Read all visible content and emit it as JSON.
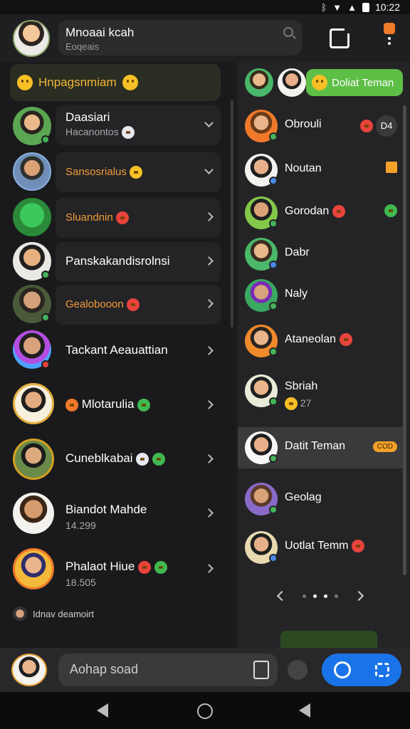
{
  "status": {
    "time": "10:22"
  },
  "header": {
    "title": "Mnoaai kcah",
    "subtitle": "Eoqeais"
  },
  "promo": {
    "text": "Hnpagsnmiam"
  },
  "chats": [
    {
      "name": "Daasiari",
      "sub": "Hacanontos",
      "style": "white"
    },
    {
      "name": "Sansosrialus",
      "sub": "",
      "style": "orange"
    },
    {
      "name": "Sluandnin",
      "sub": "",
      "style": "orange"
    },
    {
      "name": "Panskakandisrolnsi",
      "sub": "",
      "style": "white"
    },
    {
      "name": "Gealobooon",
      "sub": "",
      "style": "orange"
    },
    {
      "name": "Tackant Aeauattian",
      "sub": "",
      "style": "white"
    },
    {
      "name": "Mlotarulia",
      "sub": "",
      "style": "white"
    },
    {
      "name": "Cuneblkabai",
      "sub": "",
      "style": "white"
    },
    {
      "name": "Biandot Mahde",
      "sub": "14.299",
      "style": "white"
    },
    {
      "name": "Phalaot Hiue",
      "sub": "18.505",
      "style": "white"
    }
  ],
  "divider": {
    "text": "Idnav deamoirt"
  },
  "add_friend": {
    "label": "Doliat Teman"
  },
  "friends": [
    {
      "name": "Obrouli",
      "sub": "",
      "tag": "D4"
    },
    {
      "name": "Noutan",
      "sub": ""
    },
    {
      "name": "Gorodan",
      "sub": ""
    },
    {
      "name": "Dabr",
      "sub": ""
    },
    {
      "name": "Naly",
      "sub": ""
    },
    {
      "name": "Ataneolan",
      "sub": ""
    },
    {
      "name": "Sbriah",
      "sub": "27"
    },
    {
      "name": "Datit Teman",
      "sub": "",
      "tag": "COD"
    },
    {
      "name": "Geolag",
      "sub": ""
    },
    {
      "name": "Uotlat Temm",
      "sub": ""
    }
  ],
  "composer": {
    "placeholder": "Aohap soad"
  }
}
